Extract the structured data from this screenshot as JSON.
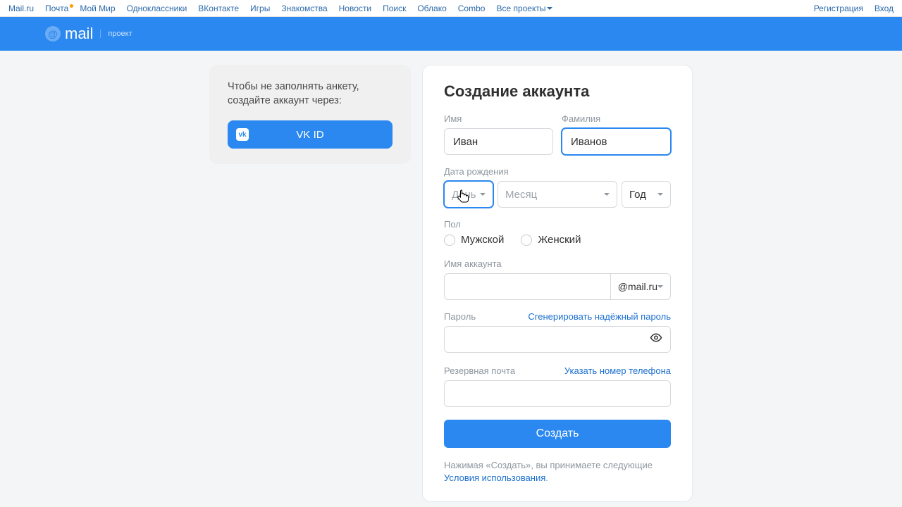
{
  "topnav": {
    "left": [
      "Mail.ru",
      "Почта",
      "Мой Мир",
      "Одноклассники",
      "ВКонтакте",
      "Игры",
      "Знакомства",
      "Новости",
      "Поиск",
      "Облако",
      "Combo",
      "Все проекты"
    ],
    "right": [
      "Регистрация",
      "Вход"
    ]
  },
  "logo": {
    "brand": "mail",
    "sub": "проект"
  },
  "side": {
    "text1": "Чтобы не заполнять анкету,",
    "text2": "создайте аккаунт через:",
    "vk_label": "VK ID",
    "vk_icon": "vk"
  },
  "form": {
    "title": "Создание аккаунта",
    "firstname_label": "Имя",
    "firstname_value": "Иван",
    "lastname_label": "Фамилия",
    "lastname_value": "Иванов",
    "dob_label": "Дата рождения",
    "dob_day_placeholder": "День",
    "dob_month_placeholder": "Месяц",
    "dob_year_placeholder": "Год",
    "gender_label": "Пол",
    "gender_male": "Мужской",
    "gender_female": "Женский",
    "account_label": "Имя аккаунта",
    "domain_value": "@mail.ru",
    "password_label": "Пароль",
    "generate_link": "Сгенерировать надёжный пароль",
    "backup_label": "Резервная почта",
    "phone_link": "Указать номер телефона",
    "submit_label": "Создать",
    "terms_prefix": "Нажимая «Создать», вы принимаете следующие ",
    "terms_link": "Условия использования",
    "terms_suffix": "."
  }
}
